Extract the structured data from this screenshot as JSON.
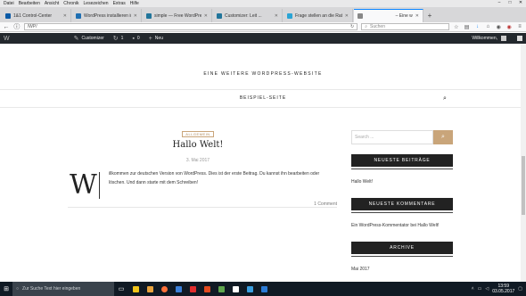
{
  "browser": {
    "menu": [
      "Datei",
      "Bearbeiten",
      "Ansicht",
      "Chronik",
      "Lesezeichen",
      "Extras",
      "Hilfe"
    ],
    "window_controls": [
      "–",
      "□",
      "✕"
    ],
    "tabs": [
      {
        "title": "1&1 Control-Center",
        "favicon_color": "#0b5aa6"
      },
      {
        "title": "WordPress installieren in 5 S",
        "favicon_color": "#1f6fb2"
      },
      {
        "title": "simple — Free WordPress T",
        "favicon_color": "#21759b"
      },
      {
        "title": "Customizer: Leit ...",
        "favicon_color": "#21759b"
      },
      {
        "title": "Frage stellen an die Ratgeb",
        "favicon_color": "#2aa4d5"
      },
      {
        "title": "– Eine w",
        "favicon_color": "#888888"
      }
    ],
    "newtab": "+",
    "url": "/WP/",
    "search_placeholder": "Suchen"
  },
  "wp_admin_bar": {
    "logo": "W",
    "customizer": "Customizer",
    "updates": "1",
    "comments": "0",
    "new": "Neu",
    "greeting": "Willkommen,"
  },
  "site": {
    "tagline": "EINE WEITERE WORDPRESS-WEBSITE",
    "nav_page": "BEISPIEL-SEITE"
  },
  "post": {
    "category": "ALLGEMEIN",
    "title": "Hallo Welt!",
    "date": "3. Mai 2017",
    "dropcap": "W",
    "body": "illkommen zur deutschen Version von WordPress. Dies ist der erste Beitrag. Du kannst ihn bearbeiten oder löschen. Und dann starte mit dem Schreiben!",
    "comments": "1 Comment"
  },
  "sidebar": {
    "search_placeholder": "Search ...",
    "recent_posts_title": "NEUESTE BEITRÄGE",
    "recent_post": "Hallo Welt!",
    "recent_comments_title": "NEUESTE KOMMENTARE",
    "comment_author": "Ein WordPress-Kommentator",
    "comment_joiner": " bei ",
    "comment_post": "Hallo Welt!",
    "archive_title": "ARCHIVE",
    "archive_item": "Mai 2017"
  },
  "taskbar": {
    "search_placeholder": "Zur Suche Text hier eingeben",
    "apps": [
      "#f0c419",
      "#e8a33d",
      "#ff7139",
      "#3b80d9",
      "#e12d2d",
      "#e24a1f",
      "#5fa64d",
      "#ffffff",
      "#3a9fe0",
      "#2b7bd6"
    ],
    "time": "13:59",
    "date": "03.05.2017"
  },
  "colors": {
    "accent": "#c9a57a",
    "admin_bar": "#23282d",
    "taskbar": "#101a24"
  }
}
